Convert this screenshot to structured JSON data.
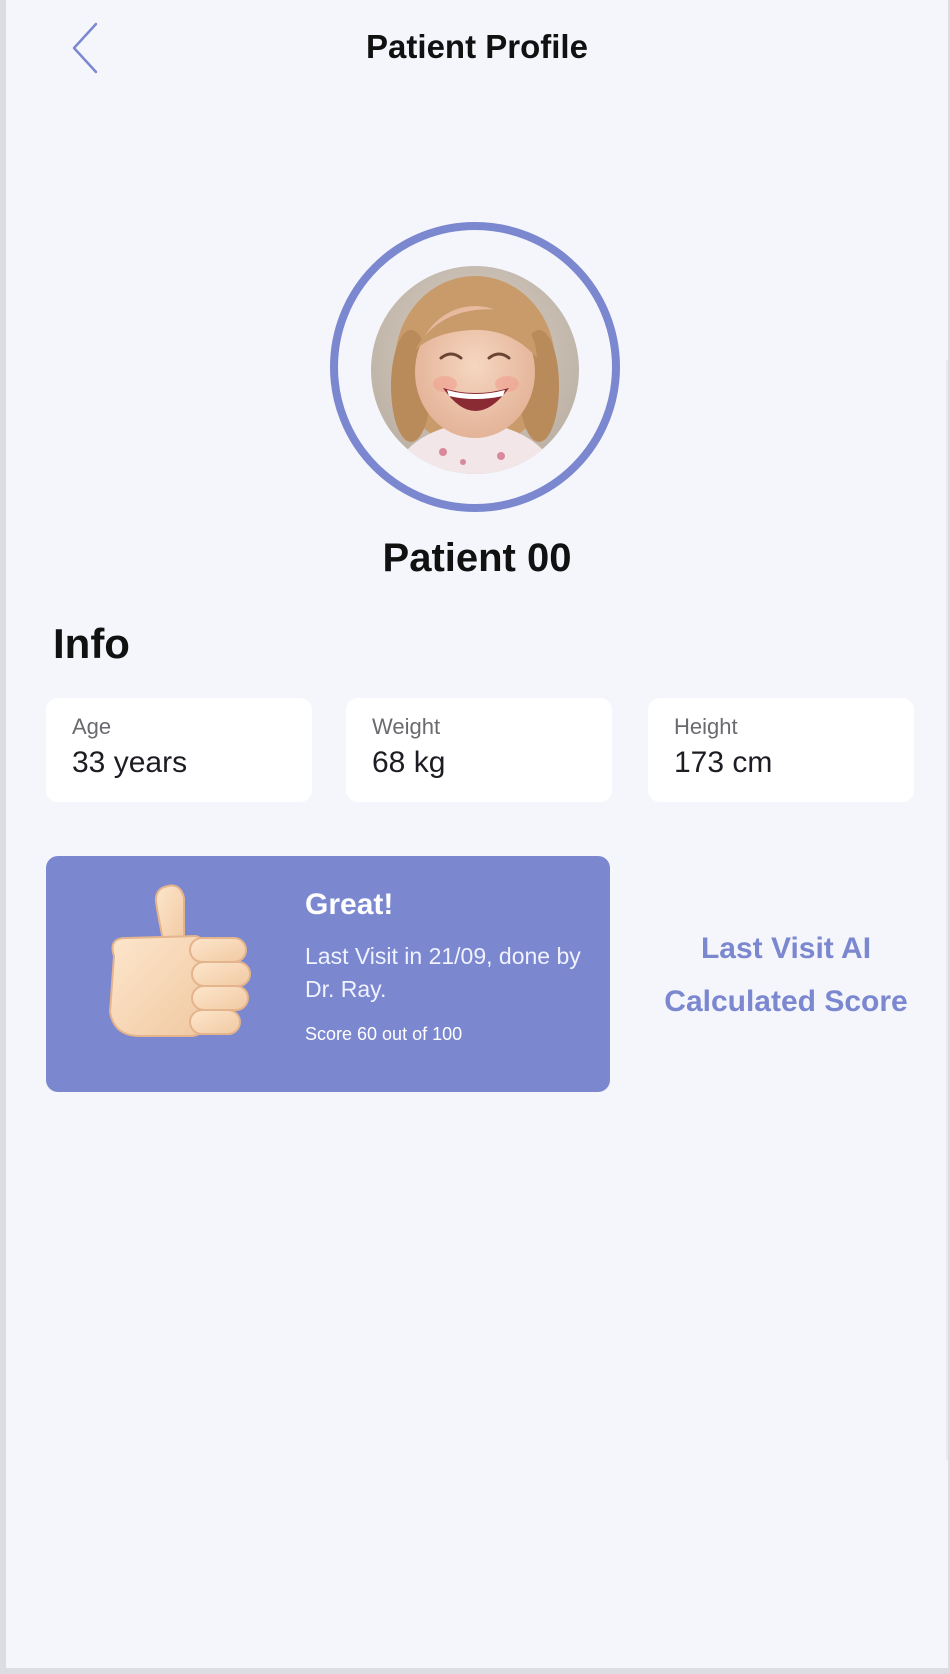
{
  "header": {
    "title": "Patient Profile",
    "back_icon": "chevron-left-icon"
  },
  "profile": {
    "name": "Patient 00",
    "avatar_description_icon": "avatar-photo"
  },
  "info": {
    "title": "Info",
    "stats": [
      {
        "label": "Age",
        "value": "33 years"
      },
      {
        "label": "Weight",
        "value": "68 kg"
      },
      {
        "label": "Height",
        "value": "173 cm"
      }
    ]
  },
  "score": {
    "icon": "thumbs-up-icon",
    "title": "Great!",
    "description": "Last Visit in 21/09, done by Dr. Ray.",
    "value_text": "Score 60 out of 100",
    "caption": "Last Visit AI Calculated Score"
  },
  "colors": {
    "accent": "#7b87cf",
    "background": "#f4f6fc",
    "card": "#ffffff"
  }
}
